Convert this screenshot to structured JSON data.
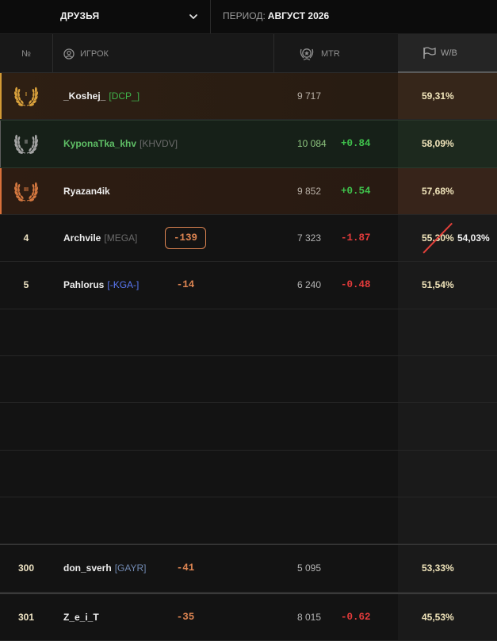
{
  "topbar": {
    "filter_label": "ДРУЗЬЯ",
    "period_label": "ПЕРИОД:",
    "period_value": "АВГУСТ 2026"
  },
  "table": {
    "headers": {
      "rank": "№",
      "player": "ИГРОК",
      "mtr": "MTR",
      "wb": "W/B"
    },
    "top_rows": [
      {
        "medal": "I",
        "medal_color": "#d9a13c",
        "name": "_Koshej_",
        "name_color": "#ededed",
        "clan": "[DCP_]",
        "clan_color": "#3fb34b",
        "mtr": "9 717",
        "mtr_color": "#b8b0a6",
        "wb": "59,31%"
      },
      {
        "medal": "II",
        "medal_color": "#a4a4a4",
        "name": "KyponaTka_khv",
        "name_color": "#5fbf66",
        "clan": "[KHVDV]",
        "clan_color": "#6b6b6b",
        "mtr": "10 084",
        "mtr_color": "#8ec57f",
        "mtr_delta": "+0.84",
        "mtr_delta_color": "#3fc24c",
        "wb": "58,09%"
      },
      {
        "medal": "III",
        "medal_color": "#d3773f",
        "name": "Ryazan4ik",
        "name_color": "#ededed",
        "mtr": "9 852",
        "mtr_color": "#b8b0a6",
        "mtr_delta": "+0.54",
        "mtr_delta_color": "#3fc24c",
        "wb": "57,68%"
      }
    ],
    "rows": [
      {
        "rank": "4",
        "name": "Archvile",
        "clan": "[MEGA]",
        "clan_color": "#6b6b6b",
        "delta": "-139",
        "mtr": "7 323",
        "mtr_delta": "-1.87",
        "mtr_delta_color": "#e33b3b",
        "wb_previous": "55,30%",
        "wb": "54,03%"
      },
      {
        "rank": "5",
        "name": "Pahlorus",
        "clan": "[-KGA-]",
        "clan_color": "#5a78f4",
        "delta": "-14",
        "mtr": "6 240",
        "mtr_delta": "-0.48",
        "mtr_delta_color": "#e33b3b",
        "wb": "51,54%"
      },
      {
        "rank": "300",
        "name": "don_sverh",
        "clan": "[GAYR]",
        "clan_color": "#7088b0",
        "delta": "-41",
        "mtr": "5 095",
        "wb": "53,33%"
      },
      {
        "rank": "301",
        "name": "Z_e_i_T",
        "delta": "-35",
        "mtr": "8 015",
        "mtr_delta": "-0.62",
        "mtr_delta_color": "#e33b3b",
        "wb": "45,53%"
      }
    ]
  },
  "icons": {
    "filter_dropdown": "chevron-down-icon",
    "player_header": "user-circle-icon",
    "mtr_header": "rating-emblem-icon",
    "wb_header": "flag-icon",
    "top_rank": "laurel-wreath-icon"
  },
  "colors": {
    "accent_orange": "#de8552",
    "wb_text": "#f0e4ba",
    "rank_text": "#efe4c4",
    "strike": "#e0403a"
  }
}
